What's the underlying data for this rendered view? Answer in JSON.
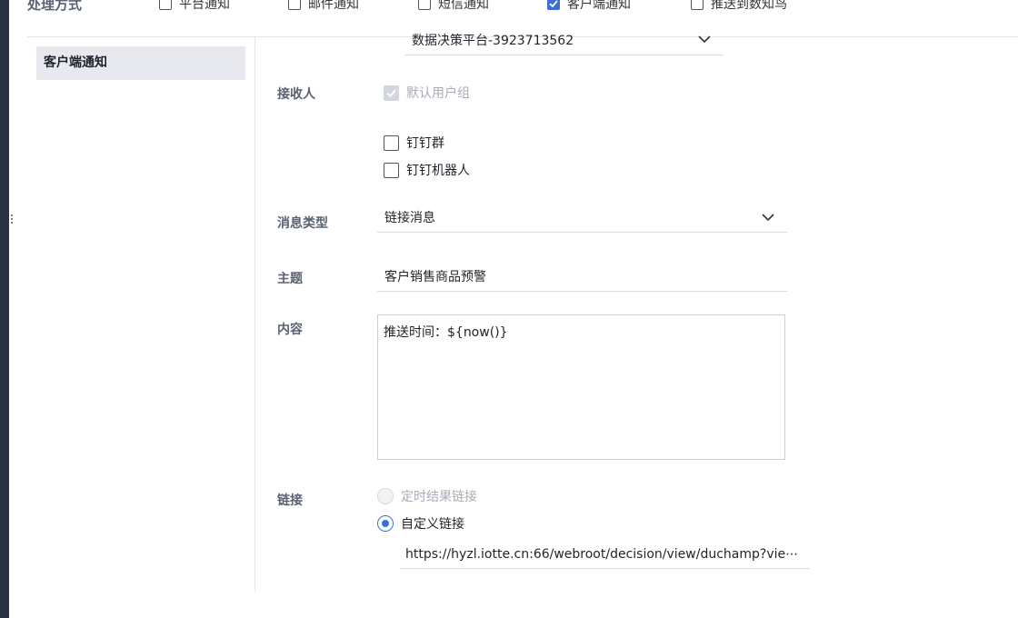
{
  "header": {
    "title": "处理方式",
    "options": [
      {
        "label": "平台通知",
        "checked": false
      },
      {
        "label": "邮件通知",
        "checked": false
      },
      {
        "label": "短信通知",
        "checked": false
      },
      {
        "label": "客户端通知",
        "checked": true
      },
      {
        "label": "推送到数知鸟",
        "checked": false
      }
    ]
  },
  "sidebar": {
    "active_item": "客户端通知"
  },
  "form": {
    "platform_select": "数据决策平台-3923713562",
    "recipients_label": "接收人",
    "recipients": {
      "default_group": {
        "label": "默认用户组",
        "checked": true,
        "disabled": true
      },
      "dingtalk_group": {
        "label": "钉钉群",
        "checked": false
      },
      "dingtalk_robot": {
        "label": "钉钉机器人",
        "checked": false
      }
    },
    "message_type_label": "消息类型",
    "message_type_value": "链接消息",
    "subject_label": "主题",
    "subject_value": "客户销售商品预警",
    "content_label": "内容",
    "content_value": "推送时间：${now()}",
    "link_label": "链接",
    "link_options": {
      "scheduled": {
        "label": "定时结果链接",
        "selected": false,
        "disabled": true
      },
      "custom": {
        "label": "自定义链接",
        "selected": true
      }
    },
    "link_value": "https://hyzl.iotte.cn:66/webroot/decision/view/duchamp?vie⋯"
  },
  "colors": {
    "accent": "#3b6fd6",
    "rail": "#2a3140",
    "sidebar_active_bg": "#e7e9ee"
  }
}
